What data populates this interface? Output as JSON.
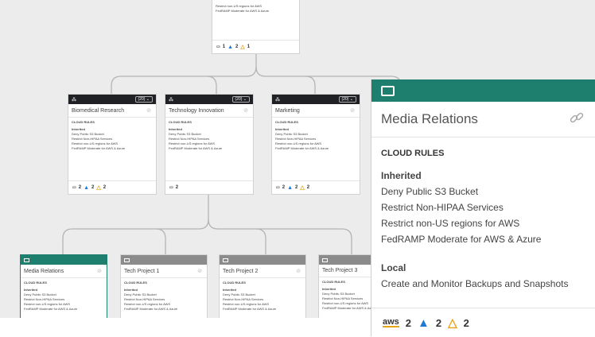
{
  "top_card": {
    "lines": [
      "Restrict non-US regions for AWS",
      "FedRAMP Moderate for AWS & Azure"
    ],
    "counts": {
      "aws": "1",
      "azure": "2",
      "gcp": "1"
    }
  },
  "level2": [
    {
      "title": "Biomedical Research",
      "badge": "(20) ⌄",
      "counts": {
        "aws": "2",
        "azure": "2",
        "gcp": "2"
      }
    },
    {
      "title": "Technology Innovation",
      "badge": "(20) ⌄",
      "counts": {
        "aws": "2"
      }
    },
    {
      "title": "Marketing",
      "badge": "(20) ⌄",
      "counts": {
        "aws": "2",
        "azure": "2",
        "gcp": "2"
      }
    }
  ],
  "level3": [
    {
      "title": "Media Relations"
    },
    {
      "title": "Tech Project 1"
    },
    {
      "title": "Tech Project 2"
    },
    {
      "title": "Tech Project 3"
    }
  ],
  "rules": {
    "section_label": "CLOUD RULES",
    "inherited_label": "Inherited",
    "inherited": [
      "Deny Public S3 Bucket",
      "Restrict Non-HIPAA Services",
      "Restrict non-US regions for AWS",
      "FedRAMP Moderate for AWS & Azure"
    ]
  },
  "panel": {
    "title": "Media Relations",
    "section_label": "CLOUD RULES",
    "inherited_label": "Inherited",
    "inherited": [
      "Deny Public S3 Bucket",
      "Restrict Non-HIPAA Services",
      "Restrict non-US regions for AWS",
      "FedRAMP Moderate for AWS & Azure"
    ],
    "local_label": "Local",
    "local": [
      "Create and Monitor Backups and Snapshots"
    ],
    "aws_label": "aws",
    "counts": {
      "aws": "2",
      "azure": "2",
      "gcp": "2"
    }
  },
  "icons": {
    "hierarchy": "hierarchy-icon",
    "link": "link-icon",
    "folder": "folder-icon",
    "azure": "azure-icon",
    "gcp": "gcp-icon"
  },
  "colors": {
    "teal": "#1e7f6e",
    "dark_header": "#202124",
    "gray_header": "#8b8b8b",
    "canvas": "#ececed"
  }
}
